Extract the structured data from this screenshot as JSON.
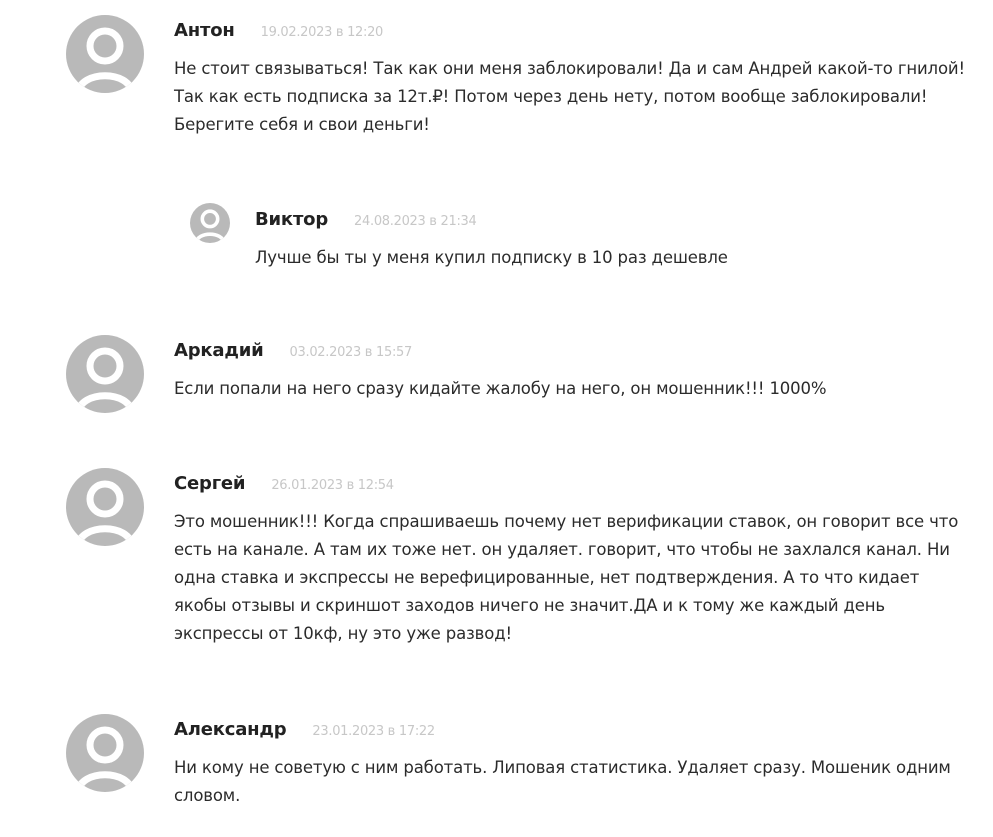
{
  "comments": [
    {
      "author": "Антон",
      "date": "19.02.2023 в 12:20",
      "text": "Не стоит связываться! Так как они меня заблокировали! Да и сам Андрей какой-то гнилой! Так как есть подписка за 12т.₽! Потом через день нету, потом вообще заблокировали! Берегите себя и свои деньги!",
      "replies": [
        {
          "author": "Виктор",
          "date": "24.08.2023 в 21:34",
          "text": "Лучше бы ты у меня купил подписку в 10 раз дешевле"
        }
      ]
    },
    {
      "author": "Аркадий",
      "date": "03.02.2023 в 15:57",
      "text": "Если попали на него сразу кидайте жалобу на него, он мошенник!!! 1000%"
    },
    {
      "author": "Сергей",
      "date": "26.01.2023 в 12:54",
      "text": "Это мошенник!!! Когда спрашиваешь почему нет верификации ставок, он говорит все что есть на канале. А там их тоже нет. он удаляет. говорит, что чтобы не захлался канал. Ни одна ставка и экспрессы не верефицированные, нет подтверждения. А то что кидает якобы отзывы и скриншот заходов ничего не значит.ДА и к тому же каждый день экспрессы от 10кф, ну это уже развод!"
    },
    {
      "author": "Александр",
      "date": "23.01.2023 в 17:22",
      "text": "Ни кому не советую с ним работать. Липовая статистика. Удаляет сразу. Мошеник одним словом."
    }
  ],
  "colors": {
    "avatar_bg": "#b9b9b9",
    "avatar_fg": "#ffffff",
    "author": "#222222",
    "date": "#c7c7c7",
    "text": "#2b2b2b"
  },
  "icons": {
    "avatar": "default-user-avatar-icon"
  }
}
